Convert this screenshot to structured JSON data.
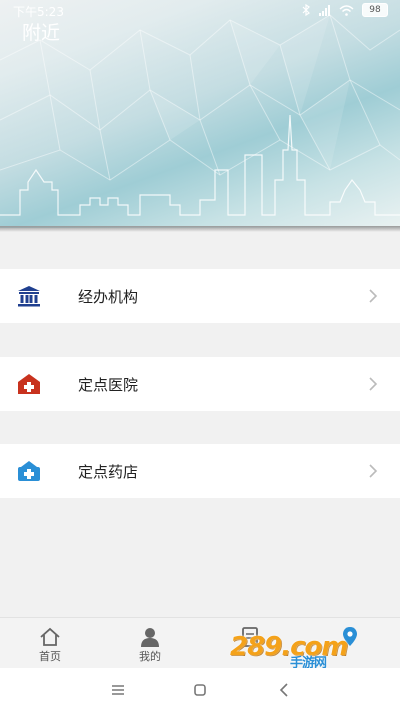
{
  "status_bar": {
    "time": "下午5:23",
    "battery": "98"
  },
  "header": {
    "title": "附近"
  },
  "menu": [
    {
      "label": "经办机构",
      "icon": "institution-icon",
      "color": "#1f3f8f"
    },
    {
      "label": "定点医院",
      "icon": "hospital-icon",
      "color": "#c8321e"
    },
    {
      "label": "定点药店",
      "icon": "pharmacy-icon",
      "color": "#2a8fd6"
    }
  ],
  "tabbar": {
    "tabs": [
      {
        "label": "首页",
        "icon": "home-icon"
      },
      {
        "label": "我的",
        "icon": "person-icon"
      },
      {
        "label": "",
        "icon": "document-icon"
      },
      {
        "label": "",
        "icon": "location-pin-icon",
        "active_color": "#2a8fd6"
      }
    ]
  },
  "watermark": {
    "text": "289.com",
    "sub": "手游网"
  },
  "colors": {
    "background": "#f1f1f1",
    "accent": "#2a8fd6"
  }
}
